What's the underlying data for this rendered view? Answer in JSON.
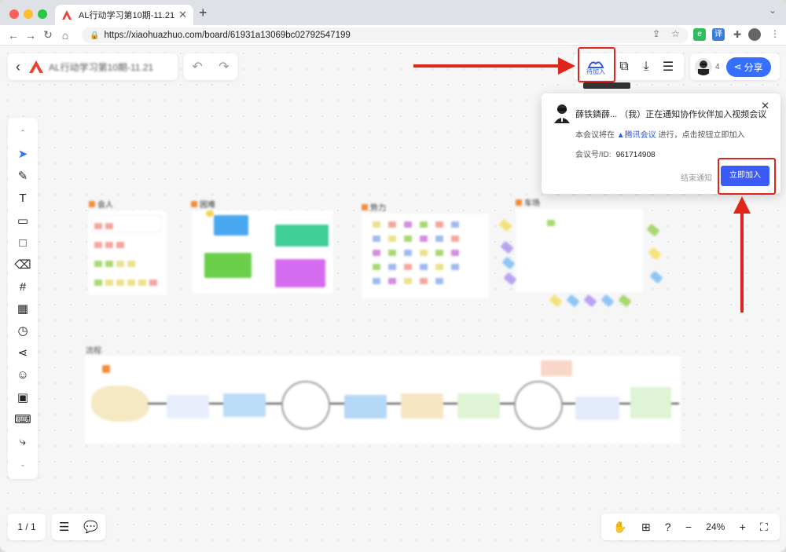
{
  "browser": {
    "tab_title": "AL行动学习第10期-11.21",
    "tab_close": "✕",
    "new_tab": "+",
    "url": "https://xiaohuazhuo.com/board/61931a13069bc02792547199"
  },
  "board": {
    "title": "AL行动学习第10期-11.21"
  },
  "header": {
    "meeting_label": "待加入",
    "member_count": "4",
    "share_label": "分享"
  },
  "notification": {
    "title": "薛铁鏻薛... （我）正在通知协作伙伴加入视频会议",
    "line_prefix": "本会议将在",
    "app_name": "腾讯会议",
    "line_suffix": "进行，点击按钮立即加入",
    "meeting_id_label": "会议号/ID:",
    "meeting_id": "961714908",
    "end_label": "结束通知",
    "join_label": "立即加入",
    "close": "✕"
  },
  "canvas": {
    "frames": [
      {
        "label": "会人"
      },
      {
        "label": "困难"
      },
      {
        "label": "势力"
      },
      {
        "label": "车场"
      },
      {
        "label": "流程"
      }
    ]
  },
  "footer": {
    "page_indicator": "1 / 1",
    "zoom": "24%"
  },
  "colors": {
    "accent": "#3370ff",
    "annotation": "#e0261a",
    "join_button": "#3a5bf5"
  },
  "icons": {
    "left_toolbar": [
      "collapse-up-icon",
      "select-arrow-icon",
      "pen-icon",
      "text-icon",
      "sticky-note-icon",
      "rectangle-icon",
      "eraser-icon",
      "frame-icon",
      "kanban-icon",
      "timer-icon",
      "mindmap-icon",
      "emoji-icon",
      "image-icon",
      "code-icon",
      "connector-icon",
      "expand-down-icon"
    ]
  }
}
